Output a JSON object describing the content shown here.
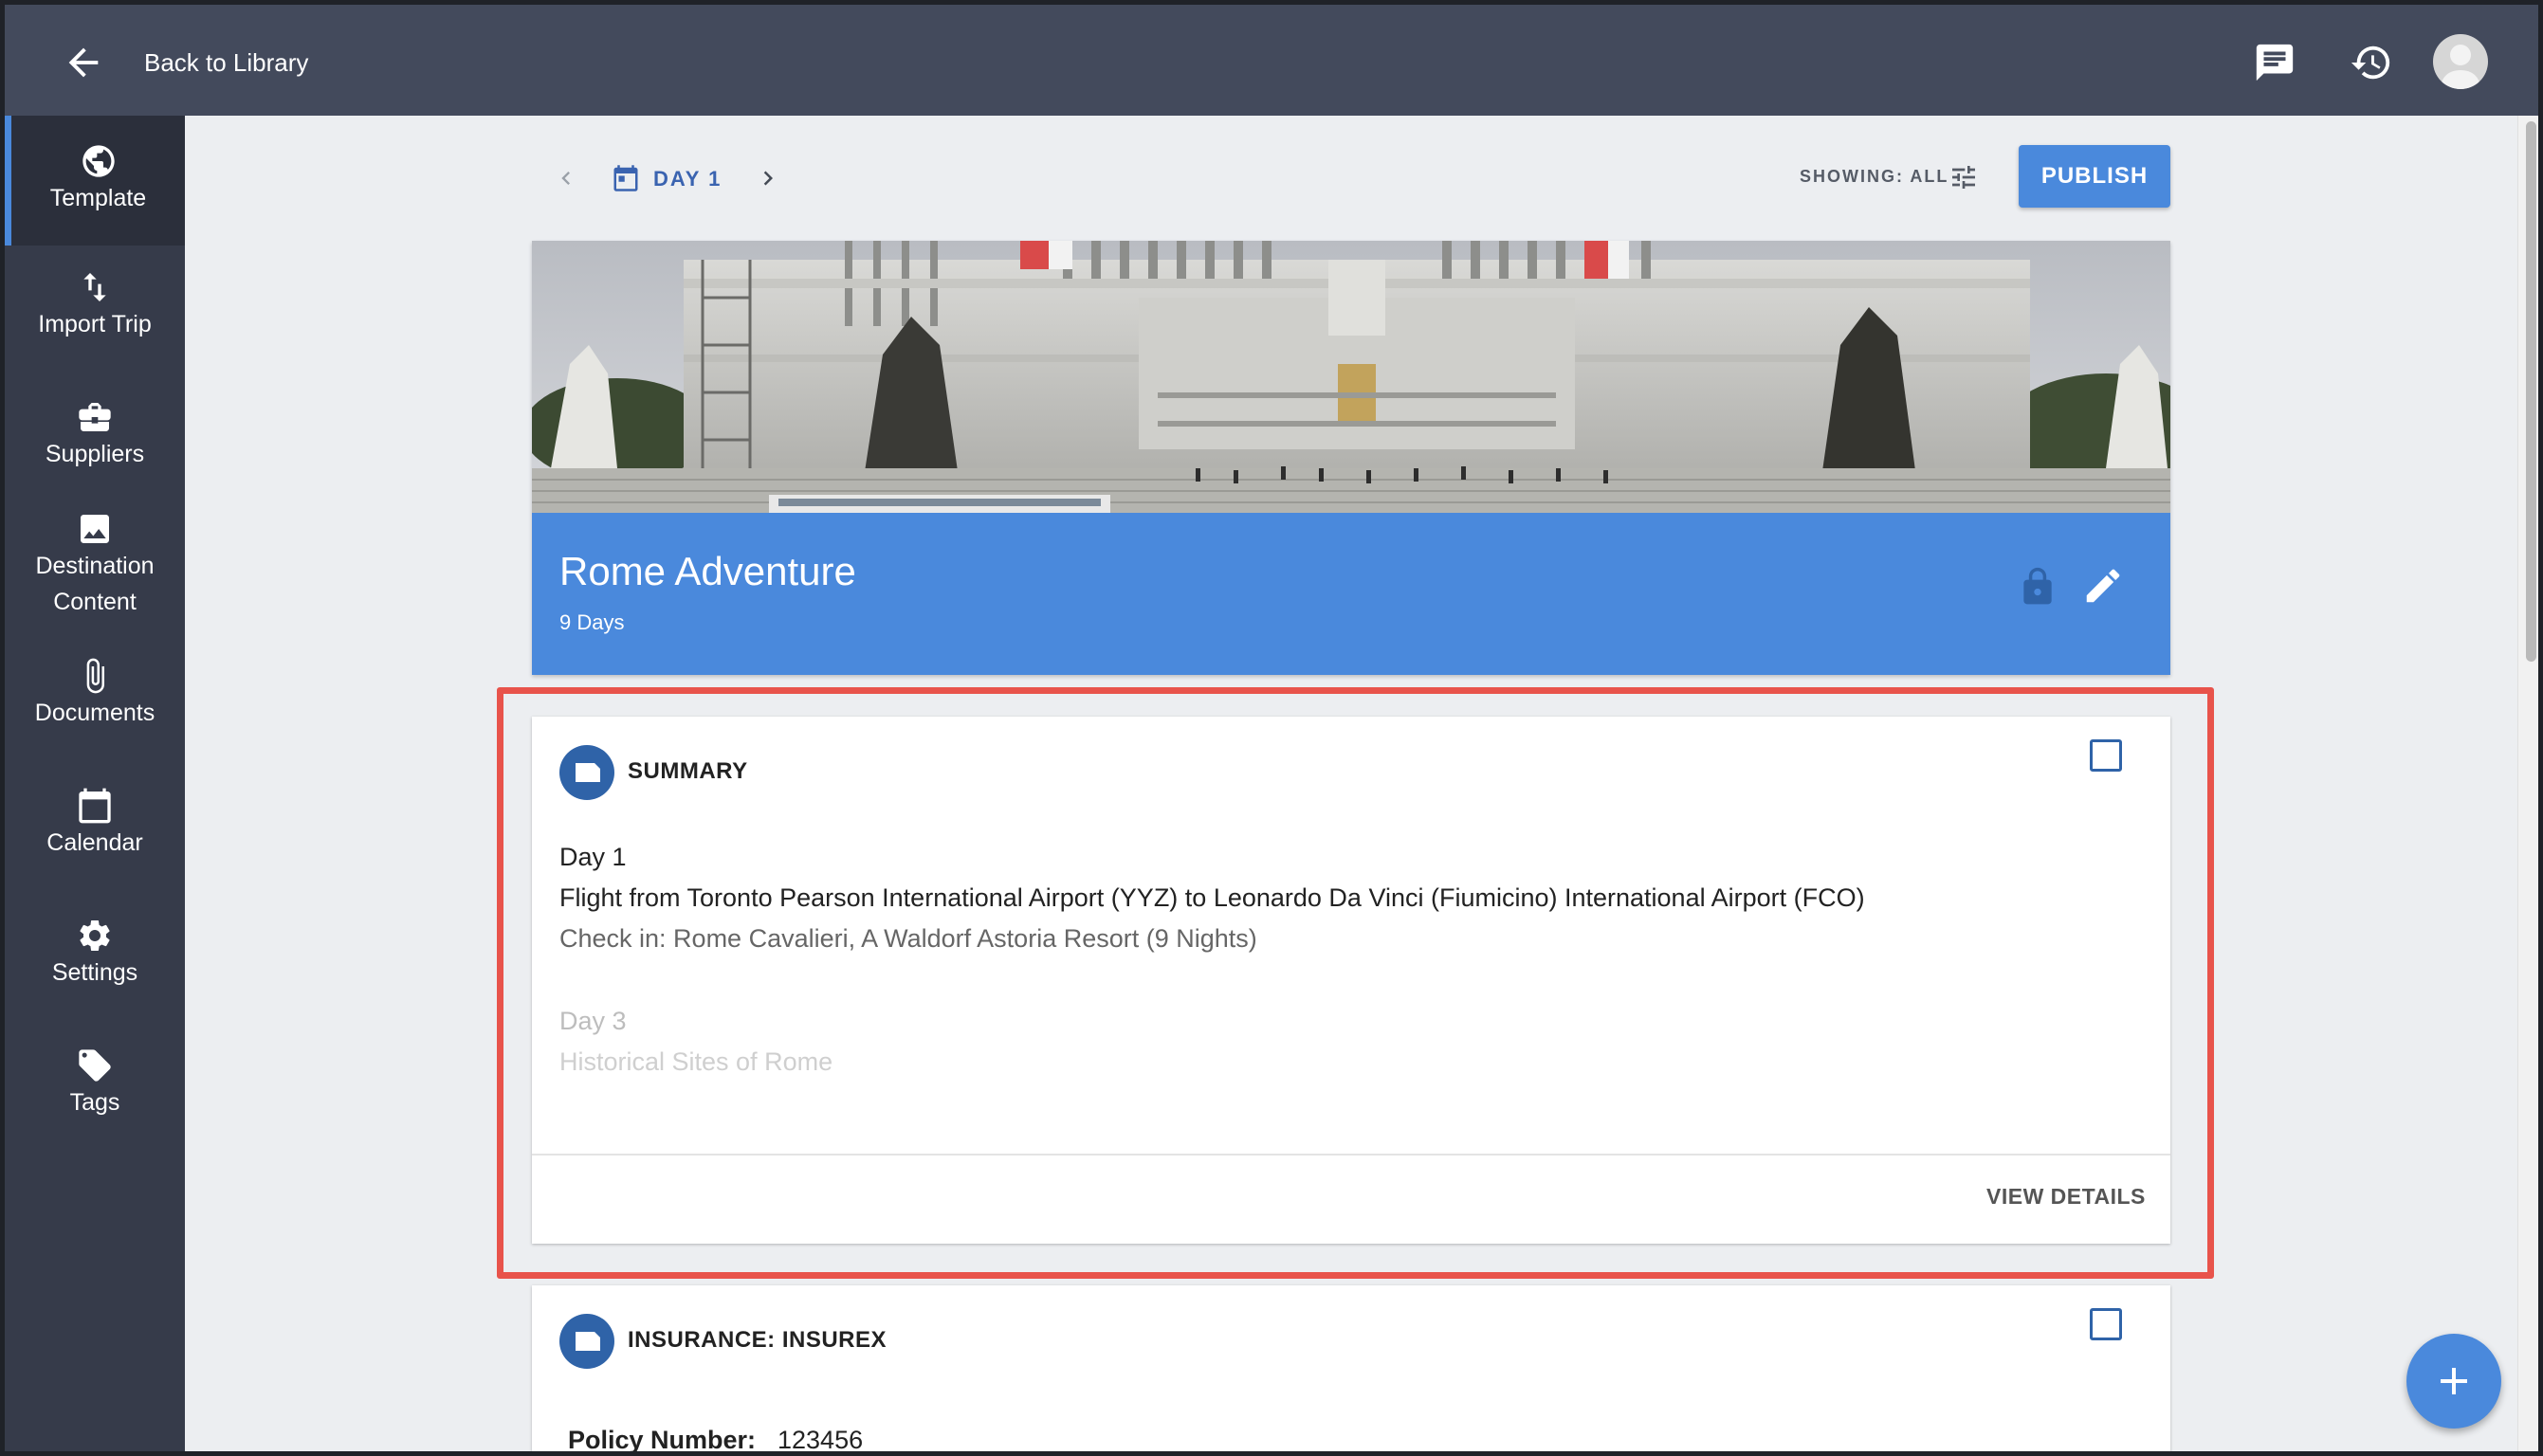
{
  "topbar": {
    "back_label": "Back to Library",
    "icons": [
      "back-arrow-icon",
      "chat-icon",
      "history-icon",
      "avatar"
    ]
  },
  "sidebar": {
    "items": [
      {
        "label": "Template",
        "icon": "globe-icon",
        "active": true
      },
      {
        "label": "Import Trip",
        "icon": "import-arrows-icon",
        "active": false
      },
      {
        "label": "Suppliers",
        "icon": "briefcase-icon",
        "active": false
      },
      {
        "label": "Destination Content",
        "label_line1": "Destination",
        "label_line2": "Content",
        "icon": "image-icon",
        "active": false
      },
      {
        "label": "Documents",
        "icon": "paperclip-icon",
        "active": false
      },
      {
        "label": "Calendar",
        "icon": "calendar-icon",
        "active": false
      },
      {
        "label": "Settings",
        "icon": "gear-icon",
        "active": false
      },
      {
        "label": "Tags",
        "icon": "tag-icon",
        "active": false
      }
    ]
  },
  "toolbar": {
    "day_label": "DAY 1",
    "showing_label": "SHOWING: ALL",
    "publish_label": "PUBLISH"
  },
  "trip": {
    "title": "Rome Adventure",
    "duration": "9 Days"
  },
  "summary_card": {
    "title": "SUMMARY",
    "lines": [
      "Day 1",
      "Flight from Toronto Pearson International Airport (YYZ) to Leonardo Da Vinci (Fiumicino) International Airport (FCO)",
      "Check in: Rome Cavalieri, A Waldorf Astoria Resort (9 Nights)",
      "Day 3",
      "Historical Sites of Rome"
    ],
    "view_details_label": "VIEW DETAILS"
  },
  "insurance_card": {
    "title": "INSURANCE: INSUREX",
    "policy_label": "Policy Number:",
    "policy_value": "123456"
  },
  "colors": {
    "topbar": "#434a5c",
    "sidebar": "#363b4a",
    "accent": "#4a89dc",
    "highlight": "#e8534b",
    "card_icon": "#2f63a8"
  }
}
